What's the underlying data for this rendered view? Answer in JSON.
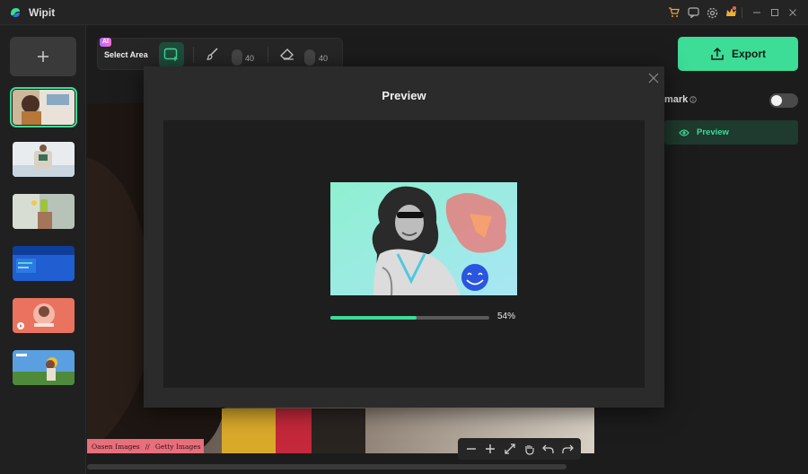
{
  "app": {
    "title": "Wipit"
  },
  "titlebar": {
    "icons": [
      "cart-icon",
      "feedback-icon",
      "settings-icon",
      "premium-icon"
    ],
    "window_controls": [
      "minimize-icon",
      "maximize-icon",
      "close-icon"
    ]
  },
  "sidebar": {
    "add_icon": "plus-icon",
    "thumbnails": [
      {
        "name": "thumbnail-1",
        "selected": true
      },
      {
        "name": "thumbnail-2",
        "selected": false
      },
      {
        "name": "thumbnail-3",
        "selected": false
      },
      {
        "name": "thumbnail-4",
        "selected": false
      },
      {
        "name": "thumbnail-5",
        "selected": false
      },
      {
        "name": "thumbnail-6",
        "selected": false
      }
    ]
  },
  "toolbar": {
    "ai_badge": "AI",
    "select_area_label": "Select Area",
    "brush_size": "40",
    "eraser_size": "40"
  },
  "export": {
    "label": "Export"
  },
  "right_panel": {
    "remark_label": "mark",
    "preview_label": "Preview",
    "toggle_on": false
  },
  "canvas": {
    "credit_left": "Oasen Images",
    "credit_sep": "//",
    "credit_right": "Getty Images"
  },
  "bottom_tools": [
    "zoom-out-icon",
    "zoom-in-icon",
    "fit-icon",
    "hand-icon",
    "undo-icon",
    "redo-icon"
  ],
  "modal": {
    "title": "Preview",
    "progress_text": "54%",
    "progress": 0.54
  },
  "colors": {
    "accent": "#3ddc97",
    "background": "#1c1c1c",
    "modal": "#2b2b2b"
  }
}
